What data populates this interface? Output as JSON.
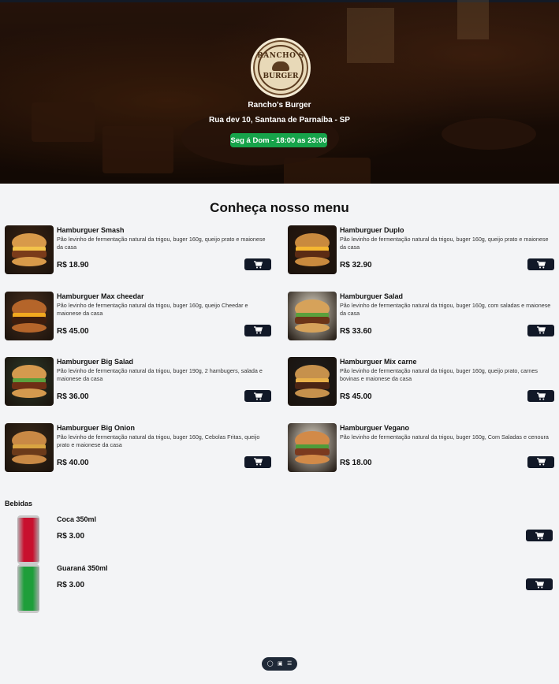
{
  "hero": {
    "logo_top": "RANCHO'S",
    "logo_bottom": "BURGER",
    "name": "Rancho's Burger",
    "address": "Rua dev 10, Santana de Parnaíba - SP",
    "hours": "Seg á Dom - 18:00 as 23:00"
  },
  "menu": {
    "title": "Conheça nosso menu",
    "items": [
      {
        "name": "Hamburguer Smash",
        "desc": "Pão levinho de fermentação natural da trigou, buger 160g, queijo prato e maionese da casa",
        "price": "R$ 18.90"
      },
      {
        "name": "Hamburguer Duplo",
        "desc": "Pão levinho de fermentação natural da trigou, buger 160g, queijo prato e maionese da casa",
        "price": "R$ 32.90"
      },
      {
        "name": "Hamburguer Max cheedar",
        "desc": "Pão levinho de fermentação natural da trigou, buger 160g, queijo Cheedar e maionese da casa",
        "price": "R$ 45.00"
      },
      {
        "name": "Hamburguer Salad",
        "desc": "Pão levinho de fermentação natural da trigou, buger 160g, com saladas e maionese da casa",
        "price": "R$ 33.60"
      },
      {
        "name": "Hamburguer Big Salad",
        "desc": "Pão levinho de fermentação natural da trigou, buger 190g, 2 hambugers, salada e maionese da casa",
        "price": "R$ 36.00"
      },
      {
        "name": "Hamburguer Mix carne",
        "desc": "Pão levinho de fermentação natural da trigou, buger 160g, queijo prato, carnes bovinas e maionese da casa",
        "price": "R$ 45.00"
      },
      {
        "name": "Hamburguer Big Onion",
        "desc": "Pão levinho de fermentação natural da trigou, buger 160g, Cebolas Fritas, queijo prato e maionese da casa",
        "price": "R$ 40.00"
      },
      {
        "name": "Hamburguer Vegano",
        "desc": "Pão levinho de fermentação natural da trigou, buger 160g, Com Saladas e cenoura",
        "price": "R$ 18.00"
      }
    ]
  },
  "drinks": {
    "title": "Bebidas",
    "items": [
      {
        "name": "Coca 350ml",
        "price": "R$ 3.00",
        "can_color": "#c8102e"
      },
      {
        "name": "Guaraná 350ml",
        "price": "R$ 3.00",
        "can_color": "#1e9e3a"
      }
    ]
  },
  "icons": {
    "cart": "cart-icon",
    "chat": "chat-icon",
    "toggle": "toggle-icon",
    "menu": "menu-icon"
  },
  "colors": {
    "hours_badge": "#16a34a",
    "cart_button": "#111827",
    "page_bg": "#f3f4f6"
  }
}
